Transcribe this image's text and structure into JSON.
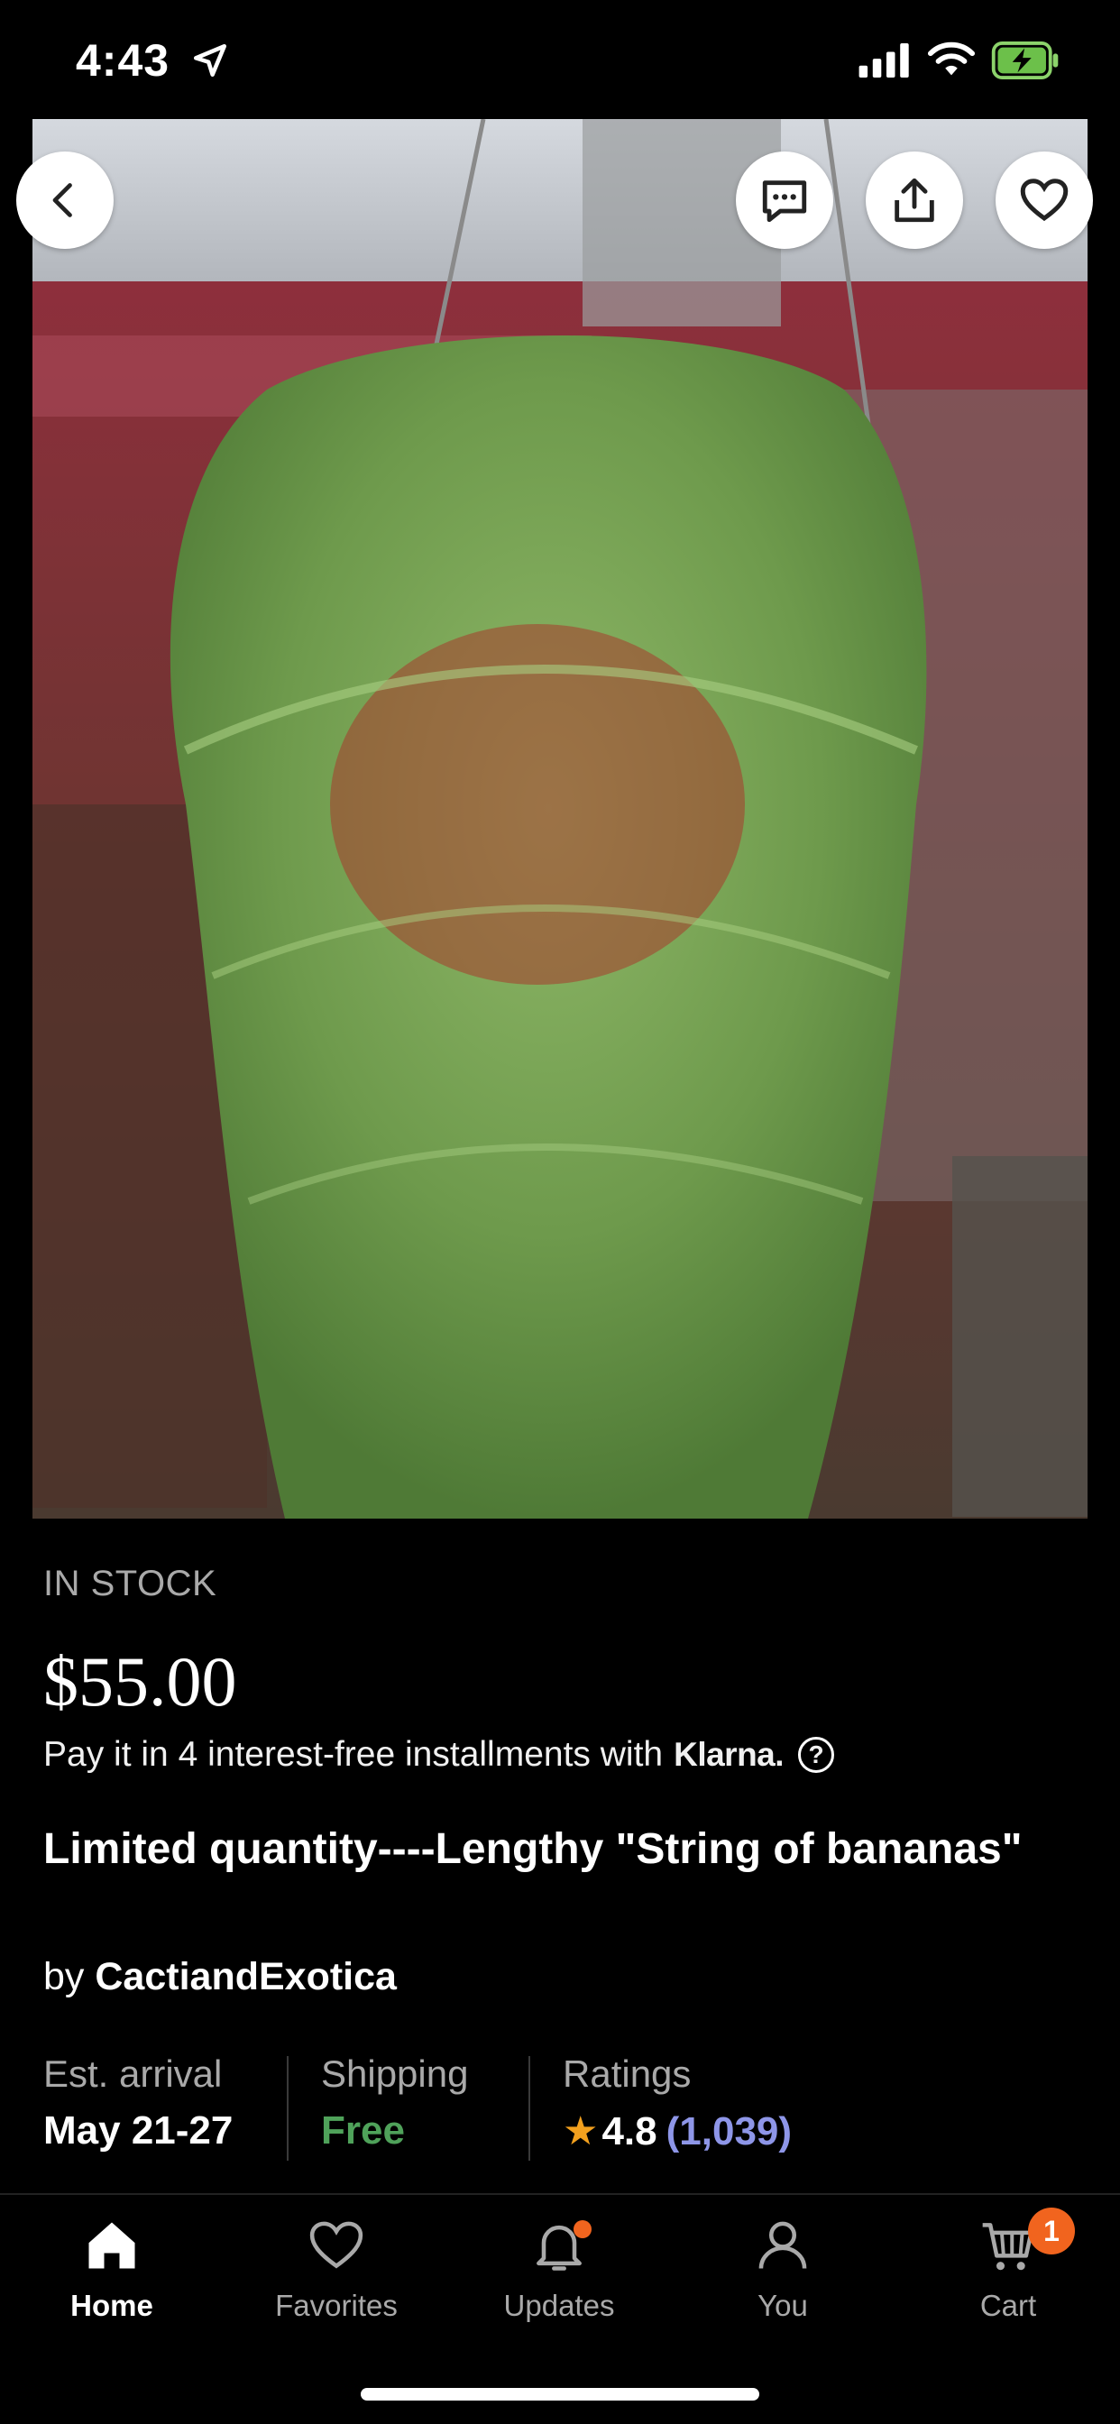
{
  "status_bar": {
    "time": "4:43"
  },
  "product": {
    "stock_status": "IN STOCK",
    "price": "$55.00",
    "installments_text": "Pay it in 4 interest-free installments with",
    "klarna_label": "Klarna.",
    "help_glyph": "?",
    "title": "Limited quantity----Lengthy \"String of bananas\"",
    "shop_prefix": "by",
    "shop_name": "CactiandExotica"
  },
  "info": {
    "arrival_label": "Est. arrival",
    "arrival_value": "May 21-27",
    "shipping_label": "Shipping",
    "shipping_value": "Free",
    "ratings_label": "Ratings",
    "rating_value": "4.8",
    "rating_count": "(1,039)"
  },
  "tabs": [
    {
      "label": "Home",
      "icon": "home-icon"
    },
    {
      "label": "Favorites",
      "icon": "heart-icon"
    },
    {
      "label": "Updates",
      "icon": "bell-icon"
    },
    {
      "label": "You",
      "icon": "person-icon"
    },
    {
      "label": "Cart",
      "icon": "cart-icon"
    }
  ],
  "cart_count": "1",
  "colors": {
    "accent_orange": "#f1641e",
    "free_green": "#4fa25a",
    "rating_blue": "#8e96e8",
    "star": "#f2a01e"
  }
}
